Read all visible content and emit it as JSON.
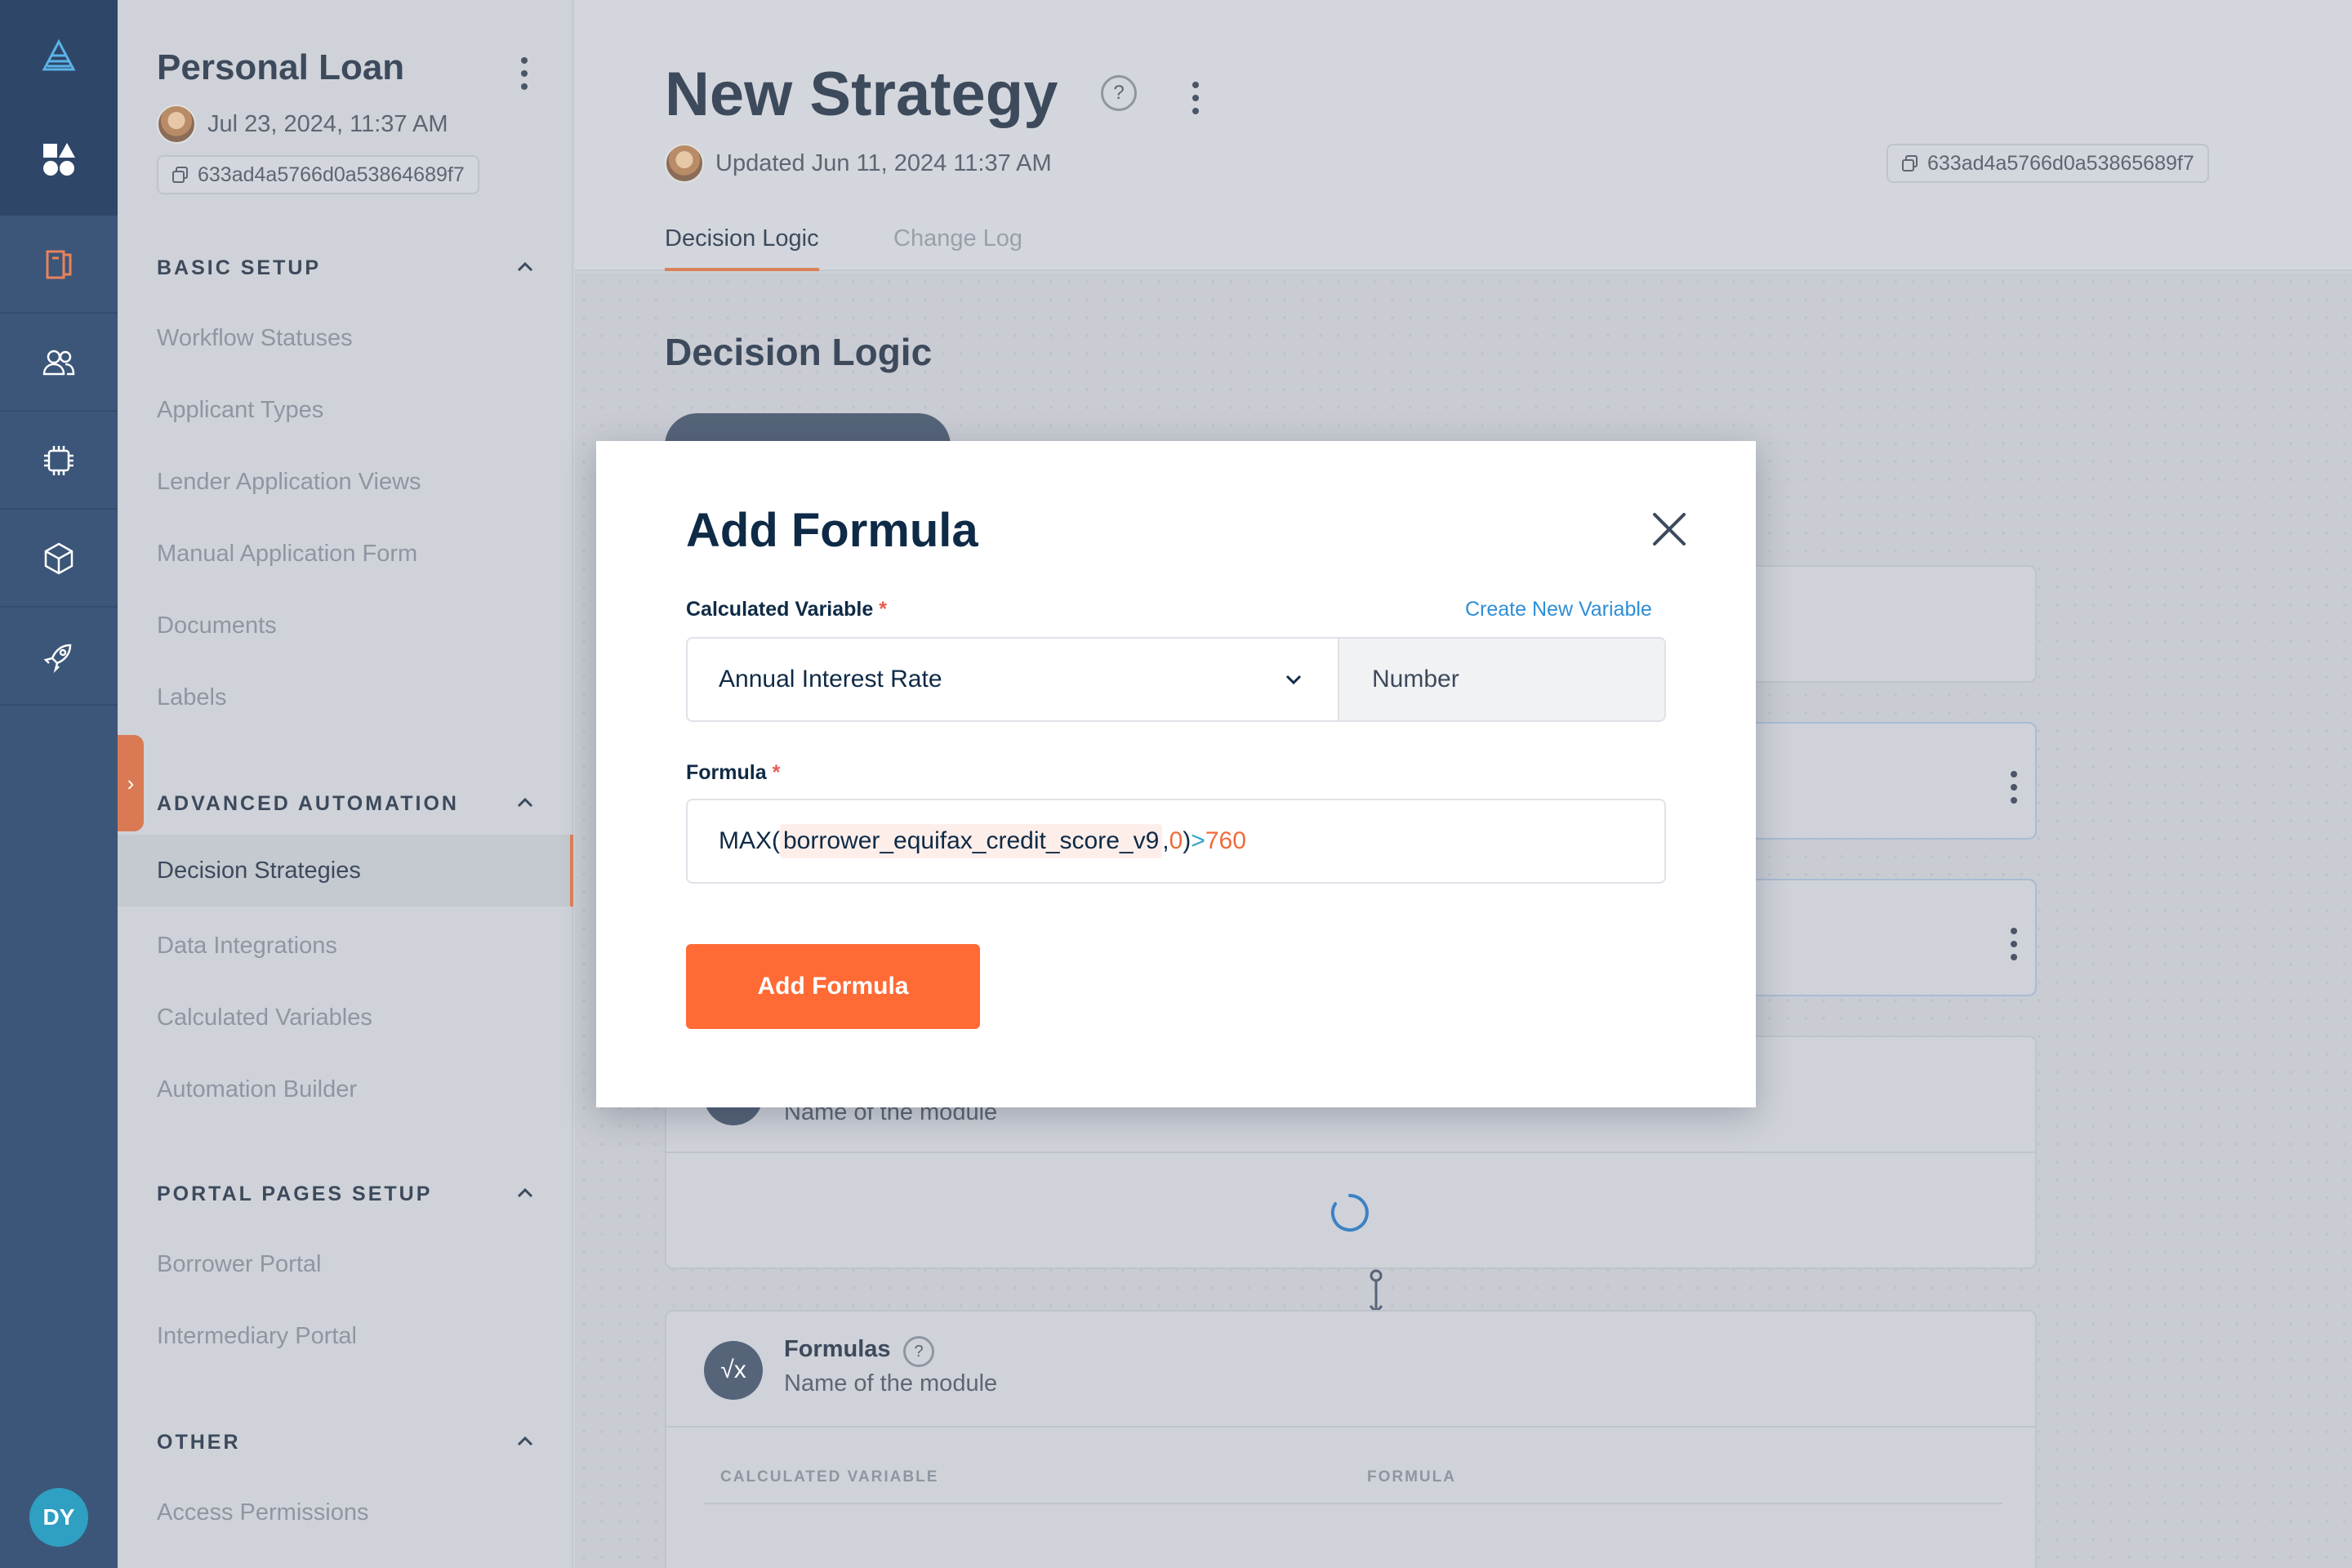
{
  "rail": {
    "items": [
      "logo-icon",
      "apps-icon",
      "book-icon",
      "users-icon",
      "chip-icon",
      "box-icon",
      "rocket-icon"
    ],
    "user_initials": "DY",
    "colors": {
      "bg": "#3b5679",
      "active": "#d9825a"
    }
  },
  "sidebar": {
    "title": "Personal Loan",
    "date": "Jul 23, 2024, 11:37 AM",
    "id": "633ad4a5766d0a53864689f7",
    "sections": [
      {
        "title": "BASIC SETUP",
        "items": [
          "Workflow Statuses",
          "Applicant Types",
          "Lender Application Views",
          "Manual Application Form",
          "Documents",
          "Labels"
        ]
      },
      {
        "title": "ADVANCED AUTOMATION",
        "items": [
          "Decision Strategies",
          "Data Integrations",
          "Calculated Variables",
          "Automation Builder"
        ]
      },
      {
        "title": "PORTAL PAGES SETUP",
        "items": [
          "Borrower Portal",
          "Intermediary Portal"
        ]
      },
      {
        "title": "OTHER",
        "items": [
          "Access Permissions"
        ]
      }
    ],
    "active_item": "Decision Strategies"
  },
  "main": {
    "title": "New Strategy",
    "help": "?",
    "updated": "Updated Jun 11, 2024 11:37 AM",
    "id": "633ad4a5766d0a53865689f7",
    "tabs": [
      "Decision Logic",
      "Change Log"
    ],
    "section_title": "Decision Logic",
    "modules": [
      {
        "subtitle": "Name of the module"
      },
      {
        "title": "Formulas",
        "subtitle": "Name of the module",
        "columns": [
          "CALCULATED VARIABLE",
          "FORMULA"
        ]
      }
    ]
  },
  "modal": {
    "title": "Add Formula",
    "calc_label": "Calculated Variable",
    "required_mark": "*",
    "create_link": "Create New Variable",
    "selected_variable": "Annual Interest Rate",
    "variable_type": "Number",
    "formula_label": "Formula",
    "formula": {
      "func": "MAX(",
      "variable": "borrower_equifax_credit_score_v9",
      "comma": ",",
      "zero": "0",
      "close": ")",
      "operator": ">",
      "value": "760"
    },
    "submit_label": "Add Formula"
  }
}
